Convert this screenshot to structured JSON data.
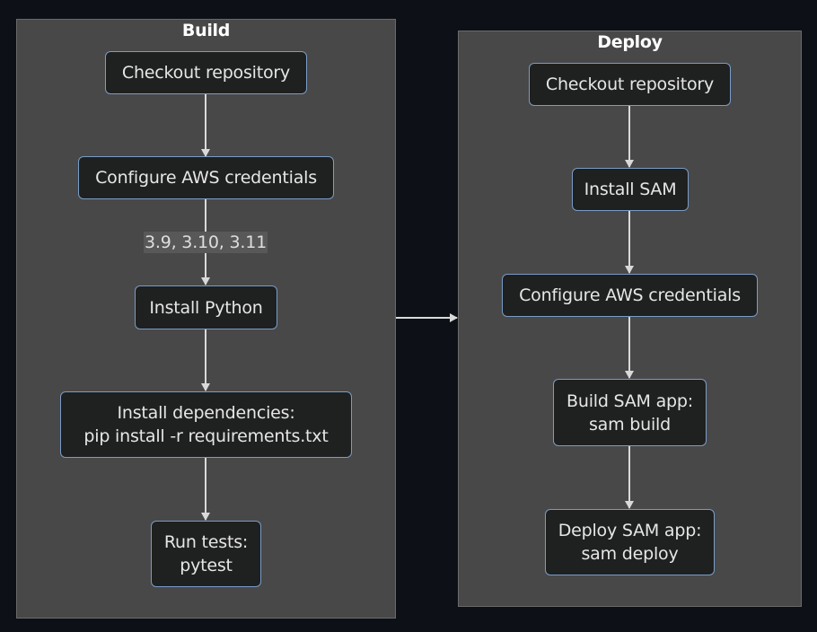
{
  "clusters": {
    "build": {
      "title": "Build",
      "nodes": [
        {
          "id": "b1",
          "lines": [
            "Checkout repository"
          ]
        },
        {
          "id": "b2",
          "lines": [
            "Configure AWS credentials"
          ]
        },
        {
          "id": "b3",
          "lines": [
            "Install Python"
          ]
        },
        {
          "id": "b4",
          "lines": [
            "Install dependencies:",
            "pip install -r requirements.txt"
          ]
        },
        {
          "id": "b5",
          "lines": [
            "Run tests:",
            "pytest"
          ]
        }
      ],
      "edges": [
        {
          "from": "b1",
          "to": "b2",
          "label": ""
        },
        {
          "from": "b2",
          "to": "b3",
          "label": "3.9, 3.10, 3.11"
        },
        {
          "from": "b3",
          "to": "b4",
          "label": ""
        },
        {
          "from": "b4",
          "to": "b5",
          "label": ""
        }
      ]
    },
    "deploy": {
      "title": "Deploy",
      "nodes": [
        {
          "id": "d1",
          "lines": [
            "Checkout repository"
          ]
        },
        {
          "id": "d2",
          "lines": [
            "Install SAM"
          ]
        },
        {
          "id": "d3",
          "lines": [
            "Configure AWS credentials"
          ]
        },
        {
          "id": "d4",
          "lines": [
            "Build SAM app:",
            "sam build"
          ]
        },
        {
          "id": "d5",
          "lines": [
            "Deploy SAM app:",
            "sam deploy"
          ]
        }
      ],
      "edges": [
        {
          "from": "d1",
          "to": "d2",
          "label": ""
        },
        {
          "from": "d2",
          "to": "d3",
          "label": ""
        },
        {
          "from": "d3",
          "to": "d4",
          "label": ""
        },
        {
          "from": "d4",
          "to": "d5",
          "label": ""
        }
      ]
    }
  },
  "cluster_edges": [
    {
      "from": "Build",
      "to": "Deploy",
      "label": ""
    }
  ],
  "colors": {
    "background": "#0d1117",
    "cluster_fill": "#484848",
    "node_fill": "#1f2020",
    "node_border": "#7a9cc6",
    "edge": "#d9d9d9",
    "text": "#e6e6e6"
  }
}
